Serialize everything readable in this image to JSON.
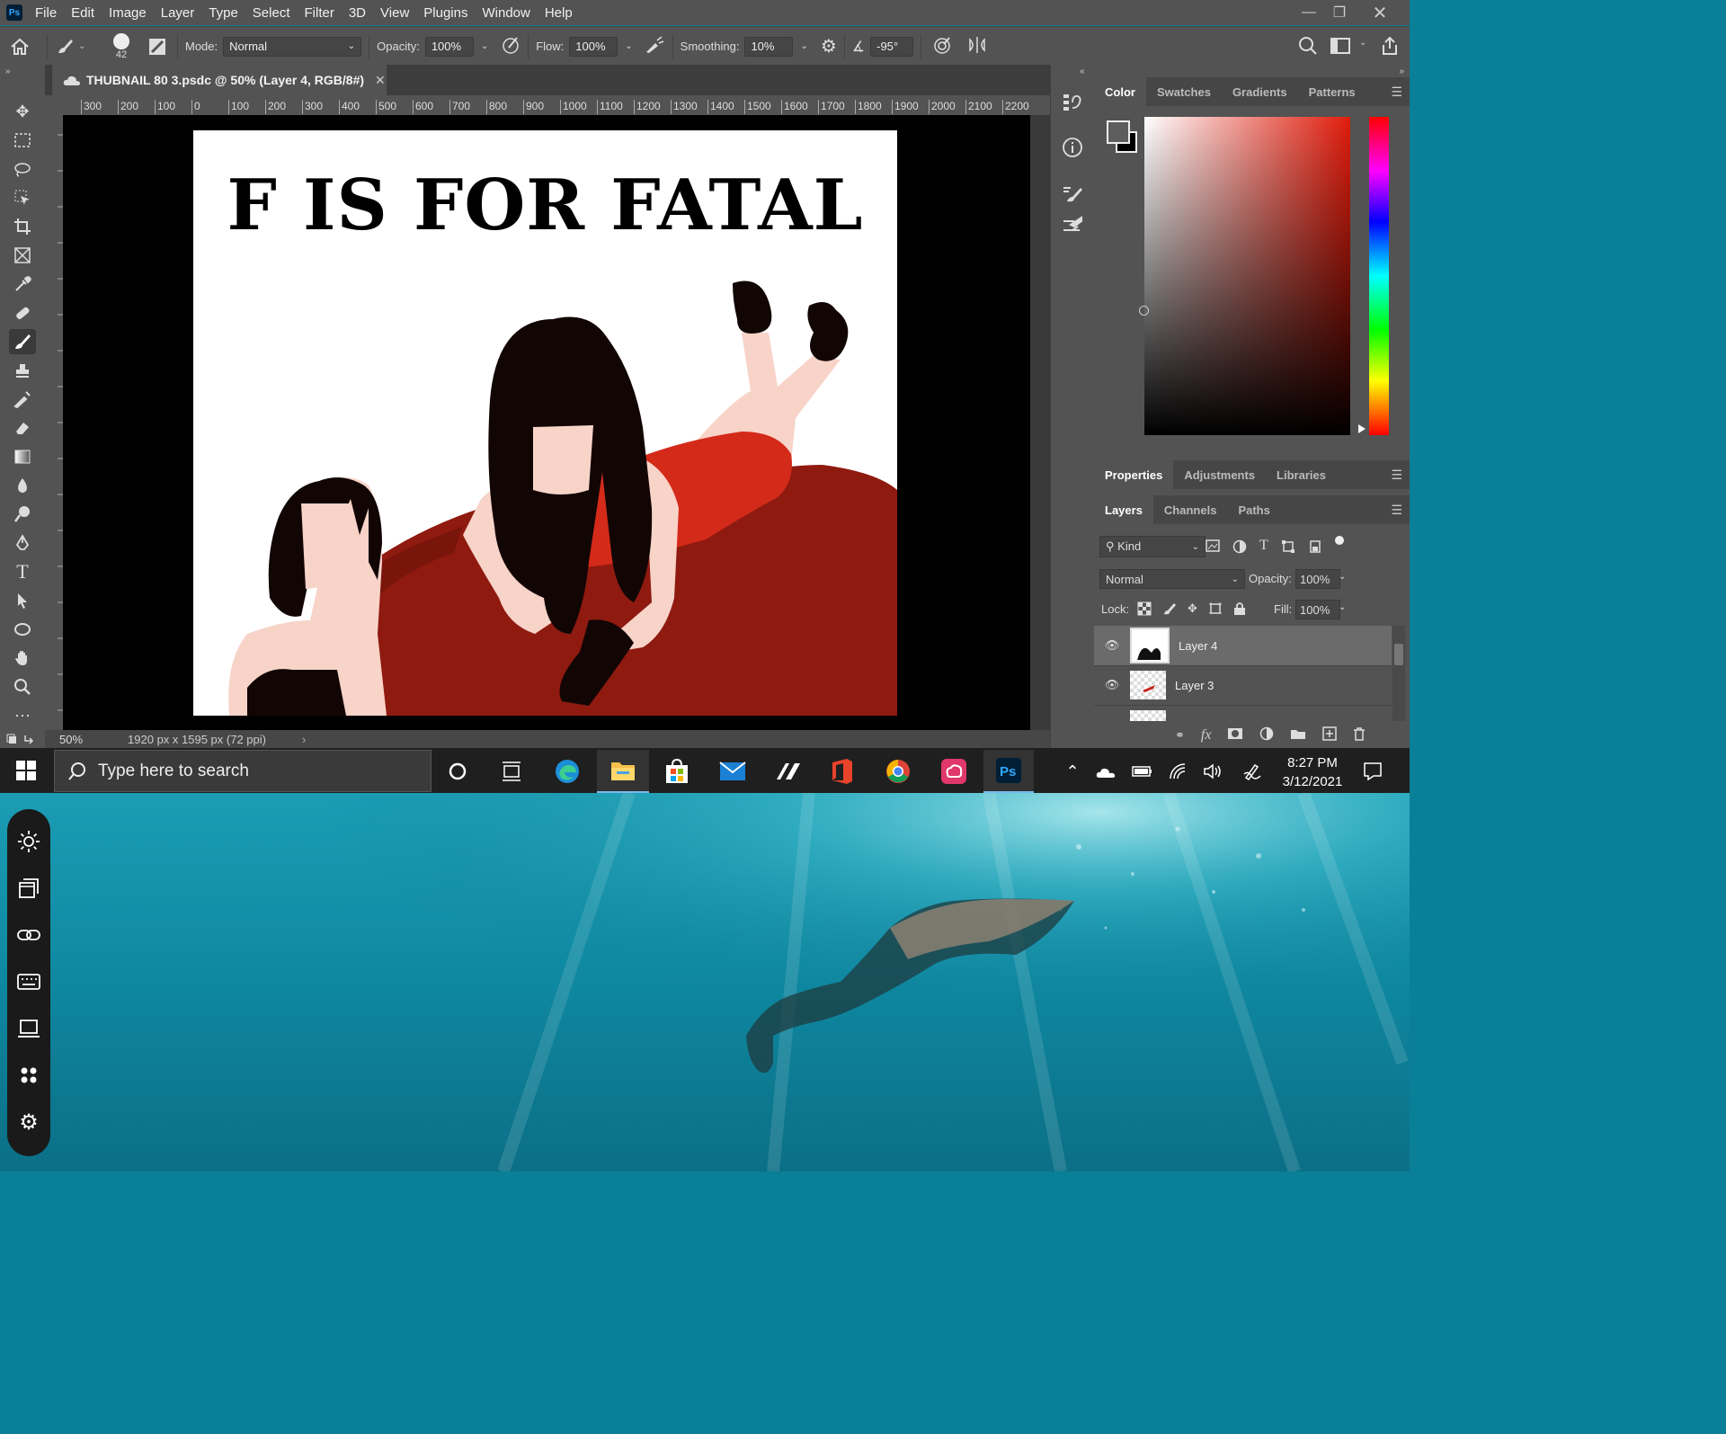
{
  "app": {
    "logo": "Ps",
    "menu": [
      "File",
      "Edit",
      "Image",
      "Layer",
      "Type",
      "Select",
      "Filter",
      "3D",
      "View",
      "Plugins",
      "Window",
      "Help"
    ]
  },
  "options": {
    "brush_size": "42",
    "mode_label": "Mode:",
    "mode_value": "Normal",
    "opacity_label": "Opacity:",
    "opacity_value": "100%",
    "flow_label": "Flow:",
    "flow_value": "100%",
    "smoothing_label": "Smoothing:",
    "smoothing_value": "10%",
    "angle_value": "-95°"
  },
  "document": {
    "tab_title": "THUBNAIL 80 3.psdc @ 50% (Layer 4, RGB/8#)",
    "ruler_labels": [
      "300",
      "200",
      "100",
      "0",
      "100",
      "200",
      "300",
      "400",
      "500",
      "600",
      "700",
      "800",
      "900",
      "1000",
      "1100",
      "1200",
      "1300",
      "1400",
      "1500",
      "1600",
      "1700",
      "1800",
      "1900",
      "2000",
      "2100",
      "2200"
    ],
    "artwork_title": "F IS FOR FATAL",
    "zoom": "50%",
    "dimensions": "1920 px x 1595 px (72 ppi)"
  },
  "color_panel": {
    "tabs": [
      "Color",
      "Swatches",
      "Gradients",
      "Patterns"
    ]
  },
  "properties_panel": {
    "tabs": [
      "Properties",
      "Adjustments",
      "Libraries"
    ]
  },
  "layers_panel": {
    "tabs": [
      "Layers",
      "Channels",
      "Paths"
    ],
    "kind_label": "Kind",
    "blend_mode": "Normal",
    "opacity_label": "Opacity:",
    "opacity_value": "100%",
    "lock_label": "Lock:",
    "fill_label": "Fill:",
    "fill_value": "100%",
    "layers": [
      {
        "name": "Layer 4",
        "selected": true
      },
      {
        "name": "Layer 3",
        "selected": false
      }
    ]
  },
  "taskbar": {
    "search_placeholder": "Type here to search",
    "time": "8:27 PM",
    "date": "3/12/2021"
  },
  "colors": {
    "ps_bg": "#535353",
    "art_red": "#d42a1a",
    "art_darkred": "#8f1a10",
    "skin": "#f8d3c8"
  }
}
